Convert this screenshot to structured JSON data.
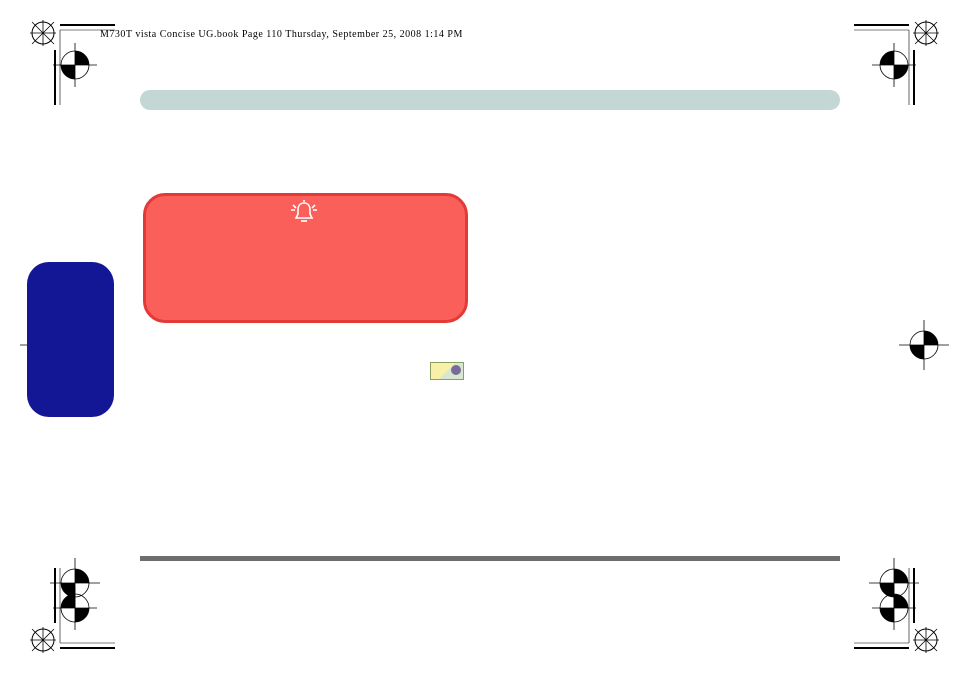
{
  "print_header": "M730T vista Concise UG.book  Page 110  Thursday, September 25, 2008  1:14 PM",
  "warning_box": {
    "icon_name": "bell-alarm"
  },
  "colors": {
    "pill": "#c3d8d4",
    "warn_bg": "#fb5f5a",
    "warn_border": "#e23a36",
    "blue_tab": "#141795",
    "footer_rule": "#6d6d6d"
  }
}
